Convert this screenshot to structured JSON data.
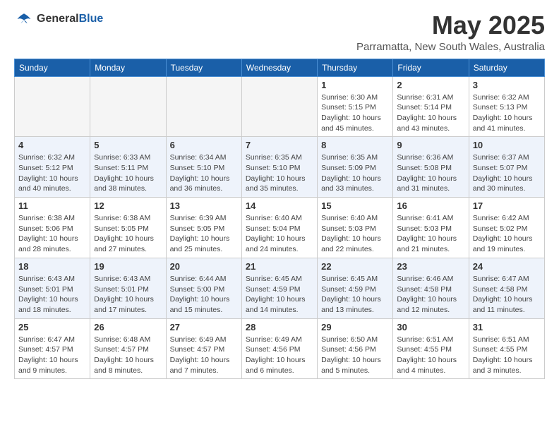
{
  "header": {
    "logo_general": "General",
    "logo_blue": "Blue",
    "title": "May 2025",
    "subtitle": "Parramatta, New South Wales, Australia"
  },
  "columns": [
    "Sunday",
    "Monday",
    "Tuesday",
    "Wednesday",
    "Thursday",
    "Friday",
    "Saturday"
  ],
  "weeks": [
    {
      "days": [
        {
          "num": "",
          "info": "",
          "empty": true
        },
        {
          "num": "",
          "info": "",
          "empty": true
        },
        {
          "num": "",
          "info": "",
          "empty": true
        },
        {
          "num": "",
          "info": "",
          "empty": true
        },
        {
          "num": "1",
          "info": "Sunrise: 6:30 AM\nSunset: 5:15 PM\nDaylight: 10 hours\nand 45 minutes.",
          "empty": false
        },
        {
          "num": "2",
          "info": "Sunrise: 6:31 AM\nSunset: 5:14 PM\nDaylight: 10 hours\nand 43 minutes.",
          "empty": false
        },
        {
          "num": "3",
          "info": "Sunrise: 6:32 AM\nSunset: 5:13 PM\nDaylight: 10 hours\nand 41 minutes.",
          "empty": false
        }
      ]
    },
    {
      "days": [
        {
          "num": "4",
          "info": "Sunrise: 6:32 AM\nSunset: 5:12 PM\nDaylight: 10 hours\nand 40 minutes.",
          "empty": false
        },
        {
          "num": "5",
          "info": "Sunrise: 6:33 AM\nSunset: 5:11 PM\nDaylight: 10 hours\nand 38 minutes.",
          "empty": false
        },
        {
          "num": "6",
          "info": "Sunrise: 6:34 AM\nSunset: 5:10 PM\nDaylight: 10 hours\nand 36 minutes.",
          "empty": false
        },
        {
          "num": "7",
          "info": "Sunrise: 6:35 AM\nSunset: 5:10 PM\nDaylight: 10 hours\nand 35 minutes.",
          "empty": false
        },
        {
          "num": "8",
          "info": "Sunrise: 6:35 AM\nSunset: 5:09 PM\nDaylight: 10 hours\nand 33 minutes.",
          "empty": false
        },
        {
          "num": "9",
          "info": "Sunrise: 6:36 AM\nSunset: 5:08 PM\nDaylight: 10 hours\nand 31 minutes.",
          "empty": false
        },
        {
          "num": "10",
          "info": "Sunrise: 6:37 AM\nSunset: 5:07 PM\nDaylight: 10 hours\nand 30 minutes.",
          "empty": false
        }
      ]
    },
    {
      "days": [
        {
          "num": "11",
          "info": "Sunrise: 6:38 AM\nSunset: 5:06 PM\nDaylight: 10 hours\nand 28 minutes.",
          "empty": false
        },
        {
          "num": "12",
          "info": "Sunrise: 6:38 AM\nSunset: 5:05 PM\nDaylight: 10 hours\nand 27 minutes.",
          "empty": false
        },
        {
          "num": "13",
          "info": "Sunrise: 6:39 AM\nSunset: 5:05 PM\nDaylight: 10 hours\nand 25 minutes.",
          "empty": false
        },
        {
          "num": "14",
          "info": "Sunrise: 6:40 AM\nSunset: 5:04 PM\nDaylight: 10 hours\nand 24 minutes.",
          "empty": false
        },
        {
          "num": "15",
          "info": "Sunrise: 6:40 AM\nSunset: 5:03 PM\nDaylight: 10 hours\nand 22 minutes.",
          "empty": false
        },
        {
          "num": "16",
          "info": "Sunrise: 6:41 AM\nSunset: 5:03 PM\nDaylight: 10 hours\nand 21 minutes.",
          "empty": false
        },
        {
          "num": "17",
          "info": "Sunrise: 6:42 AM\nSunset: 5:02 PM\nDaylight: 10 hours\nand 19 minutes.",
          "empty": false
        }
      ]
    },
    {
      "days": [
        {
          "num": "18",
          "info": "Sunrise: 6:43 AM\nSunset: 5:01 PM\nDaylight: 10 hours\nand 18 minutes.",
          "empty": false
        },
        {
          "num": "19",
          "info": "Sunrise: 6:43 AM\nSunset: 5:01 PM\nDaylight: 10 hours\nand 17 minutes.",
          "empty": false
        },
        {
          "num": "20",
          "info": "Sunrise: 6:44 AM\nSunset: 5:00 PM\nDaylight: 10 hours\nand 15 minutes.",
          "empty": false
        },
        {
          "num": "21",
          "info": "Sunrise: 6:45 AM\nSunset: 4:59 PM\nDaylight: 10 hours\nand 14 minutes.",
          "empty": false
        },
        {
          "num": "22",
          "info": "Sunrise: 6:45 AM\nSunset: 4:59 PM\nDaylight: 10 hours\nand 13 minutes.",
          "empty": false
        },
        {
          "num": "23",
          "info": "Sunrise: 6:46 AM\nSunset: 4:58 PM\nDaylight: 10 hours\nand 12 minutes.",
          "empty": false
        },
        {
          "num": "24",
          "info": "Sunrise: 6:47 AM\nSunset: 4:58 PM\nDaylight: 10 hours\nand 11 minutes.",
          "empty": false
        }
      ]
    },
    {
      "days": [
        {
          "num": "25",
          "info": "Sunrise: 6:47 AM\nSunset: 4:57 PM\nDaylight: 10 hours\nand 9 minutes.",
          "empty": false
        },
        {
          "num": "26",
          "info": "Sunrise: 6:48 AM\nSunset: 4:57 PM\nDaylight: 10 hours\nand 8 minutes.",
          "empty": false
        },
        {
          "num": "27",
          "info": "Sunrise: 6:49 AM\nSunset: 4:57 PM\nDaylight: 10 hours\nand 7 minutes.",
          "empty": false
        },
        {
          "num": "28",
          "info": "Sunrise: 6:49 AM\nSunset: 4:56 PM\nDaylight: 10 hours\nand 6 minutes.",
          "empty": false
        },
        {
          "num": "29",
          "info": "Sunrise: 6:50 AM\nSunset: 4:56 PM\nDaylight: 10 hours\nand 5 minutes.",
          "empty": false
        },
        {
          "num": "30",
          "info": "Sunrise: 6:51 AM\nSunset: 4:55 PM\nDaylight: 10 hours\nand 4 minutes.",
          "empty": false
        },
        {
          "num": "31",
          "info": "Sunrise: 6:51 AM\nSunset: 4:55 PM\nDaylight: 10 hours\nand 3 minutes.",
          "empty": false
        }
      ]
    }
  ]
}
